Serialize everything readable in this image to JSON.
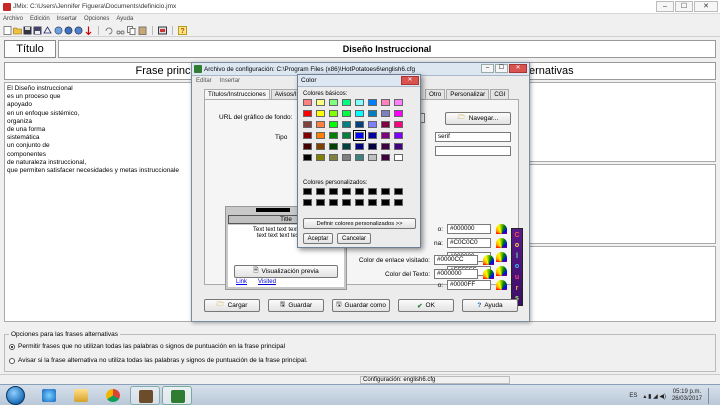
{
  "window": {
    "title": "JMix: C:\\Users\\Jennifer Figuera\\Documents\\definicio.jmx",
    "min": "–",
    "max": "☐",
    "close": "✕"
  },
  "menu": [
    "Archivo",
    "Edición",
    "Insertar",
    "Opciones",
    "Ayuda"
  ],
  "toolbar_icons": [
    "new-icon",
    "open-icon",
    "save-icon",
    "save-as-icon",
    "export-icon",
    "web-icon",
    "web2-icon",
    "arrow-icon",
    "undo-icon",
    "cut-icon",
    "copy-icon",
    "paste-icon",
    "config-icon",
    "help-icon"
  ],
  "title_row": {
    "button": "Título",
    "value": "Diseño Instruccional"
  },
  "headers": {
    "frase": "Frase princi",
    "alt": "ernativas"
  },
  "text_lines": [
    "El Diseño instruccional",
    "es un proceso que",
    "apoyado",
    "en un enfoque sistémico,",
    "organiza",
    "de una forma",
    "sistemática",
    "un conjunto de",
    "componentes",
    "de naturaleza instruccional,",
    "que permiten satisfacer necesidades y metas instruccionale"
  ],
  "options": {
    "legend": "Opciones para las frases alternativas",
    "opt1": "Permitir frases que no utilizan todas las palabras o signos de puntuación en la frase principal",
    "opt2": "Avisar si la frase alternativa no utiliza todas las palabras y signos de puntuación de la frase principal."
  },
  "status": {
    "config": "Configuración: english6.cfg"
  },
  "taskbar": {
    "lang": "ES",
    "time": "05:19 p.m.",
    "date": "26/03/2017"
  },
  "cfg_dialog": {
    "title": "Archivo de configuración: C:\\Program Files (x86)\\HotPotatoes6\\english6.cfg",
    "menu": [
      "Editar",
      "Insertar"
    ],
    "tabs": [
      "Títulos/Instrucciones",
      "Avisos/Ir"
    ],
    "tabs_right": [
      "Otro",
      "Personalizar",
      "CGI"
    ],
    "bg_url_label": "URL del gráfico de fondo:",
    "font_label": "Tipo",
    "font_value": "serif",
    "browse": "Navegar...",
    "preview": {
      "title": "Title",
      "body1": "Text text text text text tex",
      "body2": "text text text text text t",
      "link": "Link",
      "visited": "Visited"
    },
    "colors": [
      {
        "label": "o:",
        "value": "#000000"
      },
      {
        "label": "na:",
        "value": "#C0C0C0"
      },
      {
        "label": "o:",
        "value": "#000000"
      },
      {
        "label": "o:",
        "value": "#FFFFFF"
      },
      {
        "label": "o:",
        "value": "#0000FF"
      },
      {
        "label": "Color de enlace visitado:",
        "value": "#0000CC"
      },
      {
        "label": "Color del Texto:",
        "value": "#000000"
      }
    ],
    "colours_badge": [
      "C",
      "o",
      "l",
      "o",
      "u",
      "r",
      "s"
    ],
    "colours_badge_colors": [
      "#ff5252",
      "#ffd740",
      "#69f0ae",
      "#40c4ff",
      "#ff4081",
      "#ffab40",
      "#b2ff59"
    ],
    "preview_btn": "Visualización previa",
    "buttons": {
      "load": "Cargar",
      "save": "Guardar",
      "save_as": "Guardar como",
      "ok": "OK",
      "help": "Ayuda"
    }
  },
  "color_dialog": {
    "title": "Color",
    "basic_label": "Colores básicos:",
    "custom_label": "Colores personalizados:",
    "define": "Definir colores personalizados >>",
    "accept": "Aceptar",
    "cancel": "Cancelar",
    "basic_colors": [
      "#ff8080",
      "#ffff80",
      "#80ff80",
      "#00ff80",
      "#80ffff",
      "#0080ff",
      "#ff80c0",
      "#ff80ff",
      "#ff0000",
      "#ffff00",
      "#80ff00",
      "#00ff40",
      "#00ffff",
      "#0080c0",
      "#8080c0",
      "#ff00ff",
      "#804040",
      "#ff8040",
      "#00ff00",
      "#008080",
      "#004080",
      "#8080ff",
      "#800040",
      "#ff0080",
      "#800000",
      "#ff8000",
      "#008000",
      "#008040",
      "#0000ff",
      "#0000a0",
      "#800080",
      "#8000ff",
      "#400000",
      "#804000",
      "#004000",
      "#004040",
      "#000080",
      "#000040",
      "#400040",
      "#400080",
      "#000000",
      "#808000",
      "#808040",
      "#808080",
      "#408080",
      "#c0c0c0",
      "#400040",
      "#ffffff"
    ],
    "selected_index": 28
  }
}
